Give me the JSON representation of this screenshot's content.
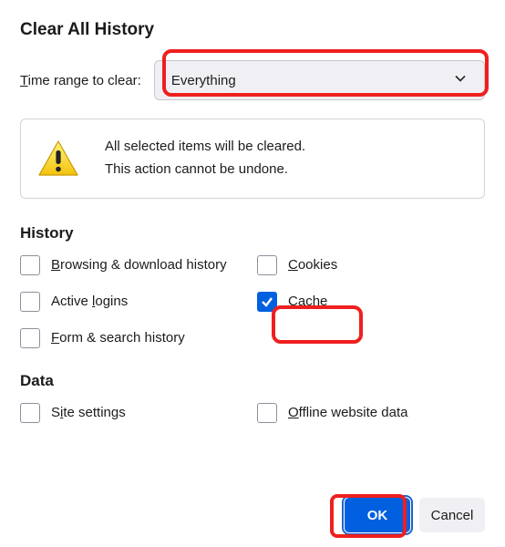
{
  "title": "Clear All History",
  "time_label_pre": "T",
  "time_label_rest": "ime range to clear:",
  "dropdown_value": "Everything",
  "warning": {
    "line1": "All selected items will be cleared.",
    "line2": "This action cannot be undone."
  },
  "sections": {
    "history": "History",
    "data": "Data"
  },
  "checks": {
    "browsing": {
      "pre": "B",
      "rest": "rowsing & download history",
      "checked": false
    },
    "cookies": {
      "pre": "C",
      "rest": "ookies",
      "checked": false
    },
    "logins": {
      "pre_plain": "Active ",
      "pre": "l",
      "rest": "ogins",
      "checked": false
    },
    "cache": {
      "pre_plain": "C",
      "pre": "a",
      "rest": "che",
      "checked": true
    },
    "form": {
      "pre": "F",
      "rest": "orm & search history",
      "checked": false
    },
    "site": {
      "pre_plain": "S",
      "pre": "i",
      "rest": "te settings",
      "checked": false
    },
    "offline": {
      "pre": "O",
      "rest": "ffline website data",
      "checked": false
    }
  },
  "buttons": {
    "ok": "OK",
    "cancel": "Cancel"
  }
}
